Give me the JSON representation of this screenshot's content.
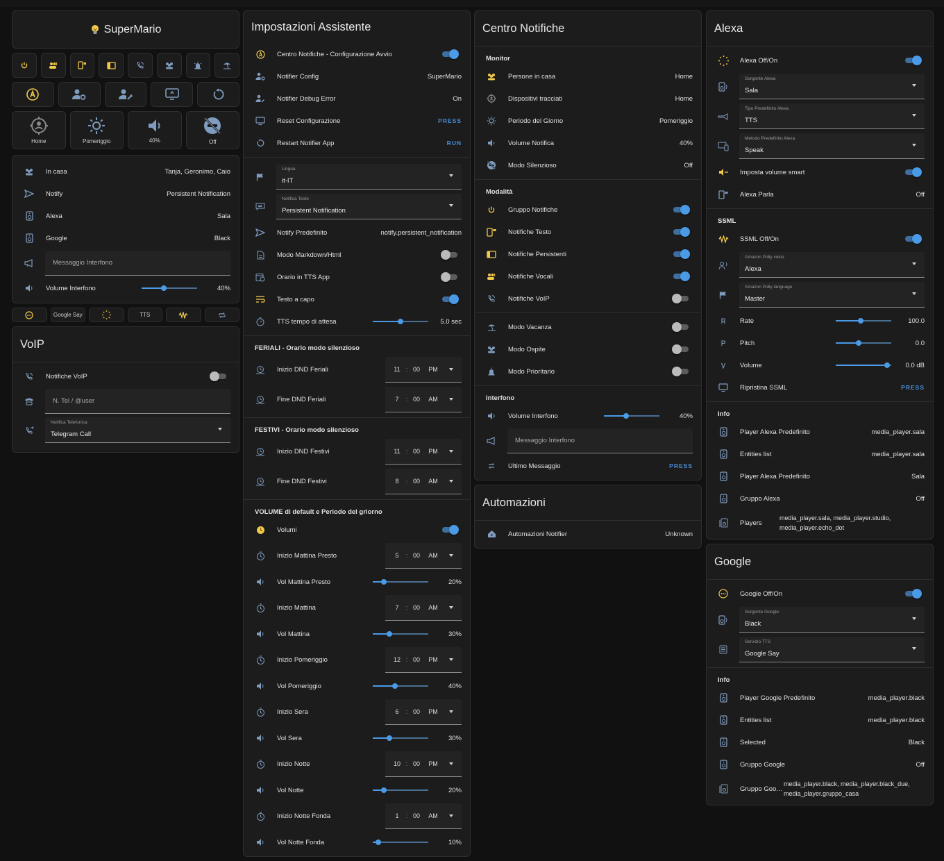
{
  "colors": {
    "accent": "#4a9ae6",
    "icon": "#7f9bbd",
    "yellow": "#f2c94c",
    "bg": "#111111",
    "card": "#1c1c1c"
  },
  "supermario": {
    "title": "SuperMario",
    "row1_icons": [
      "power-icon",
      "voice-group-icon",
      "text-notify-icon",
      "persistent-icon",
      "voip-icon",
      "guest-icon",
      "priority-icon",
      "vacation-icon"
    ],
    "row2_icons": [
      "assistant-badge-icon",
      "account-cog-icon",
      "account-wrench-icon",
      "reset-monitor-icon",
      "restart-icon"
    ],
    "big_buttons": [
      {
        "label": "Home"
      },
      {
        "label": "Pomeriggio"
      },
      {
        "label": "40%"
      },
      {
        "label": "Off"
      }
    ],
    "info": [
      {
        "label": "In casa",
        "value": "Tanja, Geronimo, Caio"
      },
      {
        "label": "Notify",
        "value": "Persistent Notification"
      },
      {
        "label": "Alexa",
        "value": "Sala"
      },
      {
        "label": "Google",
        "value": "Black"
      }
    ],
    "intercom_placeholder": "Messaggio Interfono",
    "intercom_volume_label": "Volume Interfono",
    "intercom_volume_value": "40%",
    "intercom_volume_level": 0.4,
    "chips": [
      {
        "label": ""
      },
      {
        "label": "Google Say"
      },
      {
        "label": ""
      },
      {
        "label": "TTS"
      },
      {
        "label": ""
      },
      {
        "label": ""
      }
    ]
  },
  "voip": {
    "title": "VoIP",
    "toggle_label": "Notifiche VoIP",
    "phone_placeholder": "N. Tel / @user",
    "select_label": "Notifica Telefonica",
    "select_value": "Telegram Call"
  },
  "assistente": {
    "title": "Impostazioni Assistente",
    "rows": [
      {
        "label": "Centro Notifiche - Configurazione Avvio"
      },
      {
        "label": "Notifier Config",
        "value": "SuperMario"
      },
      {
        "label": "Notifier Debug Error",
        "value": "On"
      },
      {
        "label": "Reset Configurazione",
        "action": "PRESS"
      },
      {
        "label": "Restart Notifier App",
        "action": "RUN"
      }
    ],
    "lingua_label": "Lingua",
    "lingua_value": "it-IT",
    "notifica_testo_label": "Notifica Testo",
    "notifica_testo_value": "Persistent Notification",
    "notify_predefinito_label": "Notify Predefinito",
    "notify_predefinito_value": "notify.persistent_notification",
    "markdown_label": "Modo Markdown/Html",
    "orario_tts_label": "Orario in TTS App",
    "testo_capo_label": "Testo a capo",
    "tts_wait_label": "TTS tempo di attesa",
    "tts_wait_value": "5.0 sec",
    "tts_wait_level": 0.5,
    "feriali_header": "FERIALI - Orario modo silenzioso",
    "feriali": [
      {
        "label": "Inizio DND Feriali",
        "h": "11",
        "m": "00",
        "ap": "PM"
      },
      {
        "label": "Fine DND Feriali",
        "h": "7",
        "m": "00",
        "ap": "AM"
      }
    ],
    "festivi_header": "FESTIVI - Orario modo silenzioso",
    "festivi": [
      {
        "label": "Inizio DND Festivi",
        "h": "11",
        "m": "00",
        "ap": "PM"
      },
      {
        "label": "Fine DND Festivi",
        "h": "8",
        "m": "00",
        "ap": "AM"
      }
    ],
    "volume_header": "VOLUME di default e Periodo del griorno",
    "volumi_label": "Volumi",
    "periods": [
      {
        "time_label": "Inizio Mattina Presto",
        "h": "5",
        "m": "00",
        "ap": "AM",
        "vol_label": "Vol Mattina Presto",
        "vol": "20%",
        "level": 0.2
      },
      {
        "time_label": "Inizio Mattina",
        "h": "7",
        "m": "00",
        "ap": "AM",
        "vol_label": "Vol Mattina",
        "vol": "30%",
        "level": 0.3
      },
      {
        "time_label": "Inizio Pomeriggio",
        "h": "12",
        "m": "00",
        "ap": "PM",
        "vol_label": "Vol Pomeriggio",
        "vol": "40%",
        "level": 0.4
      },
      {
        "time_label": "Inizio Sera",
        "h": "6",
        "m": "00",
        "ap": "PM",
        "vol_label": "Vol Sera",
        "vol": "30%",
        "level": 0.3
      },
      {
        "time_label": "Inizio Notte",
        "h": "10",
        "m": "00",
        "ap": "PM",
        "vol_label": "Vol Notte",
        "vol": "20%",
        "level": 0.2
      },
      {
        "time_label": "Inizio Notte Fonda",
        "h": "1",
        "m": "00",
        "ap": "AM",
        "vol_label": "Vol Notte Fonda",
        "vol": "10%",
        "level": 0.1
      }
    ]
  },
  "centro": {
    "title": "Centro Notifiche",
    "monitor_header": "Monitor",
    "monitor": [
      {
        "label": "Persone in casa",
        "value": "Home"
      },
      {
        "label": "Dispositivi tracciati",
        "value": "Home"
      },
      {
        "label": "Periodo del Giorno",
        "value": "Pomeriggio"
      },
      {
        "label": "Volume Notifica",
        "value": "40%"
      },
      {
        "label": "Modo Silenzioso",
        "value": "Off"
      }
    ],
    "modalita_header": "Modalità",
    "modalita": [
      {
        "label": "Gruppo Notifiche",
        "on": true
      },
      {
        "label": "Notifiche Testo",
        "on": true
      },
      {
        "label": "Notifiche Persistenti",
        "on": true
      },
      {
        "label": "Notifiche Vocali",
        "on": true
      },
      {
        "label": "Notifiche VoIP",
        "on": false
      }
    ],
    "modi": [
      {
        "label": "Modo Vacanza",
        "on": false
      },
      {
        "label": "Modo Ospite",
        "on": false
      },
      {
        "label": "Modo Prioritario",
        "on": false
      }
    ],
    "interfono_header": "Interfono",
    "intercom_volume_label": "Volume Interfono",
    "intercom_volume_value": "40%",
    "intercom_volume_level": 0.4,
    "intercom_placeholder": "Messaggio Interfono",
    "last_message_label": "Ultimo Messaggio",
    "last_message_action": "PRESS"
  },
  "automazioni": {
    "title": "Automazioni",
    "label": "Automazioni Notifier",
    "value": "Unknown"
  },
  "alexa": {
    "title": "Alexa",
    "onoff_label": "Alexa Off/On",
    "selects": [
      {
        "label": "Sorgente Alexa",
        "value": "Sala"
      },
      {
        "label": "Tipo Predefinito Alexa",
        "value": "TTS"
      },
      {
        "label": "Metodo Predefinito Alexa",
        "value": "Speak"
      }
    ],
    "smart_volume_label": "Imposta volume smart",
    "parla_label": "Alexa Parla",
    "parla_value": "Off",
    "ssml_header": "SSML",
    "ssml_onoff_label": "SSML Off/On",
    "ssml_selects": [
      {
        "label": "Amazon Polly voice",
        "value": "Alexa"
      },
      {
        "label": "Amazon Polly language",
        "value": "Master"
      }
    ],
    "sliders": [
      {
        "label": "Rate",
        "value": "100.0",
        "level": 0.45
      },
      {
        "label": "Pitch",
        "value": "0.0",
        "level": 0.41
      },
      {
        "label": "Volume",
        "value": "0.0 dB",
        "level": 0.93
      }
    ],
    "ripristina_label": "Ripristina SSML",
    "ripristina_action": "PRESS",
    "info_header": "Info",
    "info": [
      {
        "label": "Player Alexa Predefinito",
        "value": "media_player.sala"
      },
      {
        "label": "Entities list",
        "value": "media_player.sala"
      },
      {
        "label": "Player Alexa Predefinito",
        "value": "Sala"
      },
      {
        "label": "Gruppo Alexa",
        "value": "Off"
      }
    ],
    "players_label": "Players",
    "players_value": "media_player.sala, media_player.studio, media_player.echo_dot"
  },
  "google": {
    "title": "Google",
    "onoff_label": "Google Off/On",
    "selects": [
      {
        "label": "Sorgente Google",
        "value": "Black"
      },
      {
        "label": "Servizio TTS",
        "value": "Google Say"
      }
    ],
    "info_header": "Info",
    "info": [
      {
        "label": "Player Google Predefinito",
        "value": "media_player.black"
      },
      {
        "label": "Entities list",
        "value": "media_player.black"
      },
      {
        "label": "Selected",
        "value": "Black"
      },
      {
        "label": "Gruppo Google",
        "value": "Off"
      }
    ],
    "group2_label": "Gruppo Goog...",
    "group2_value": "media_player.black, media_player.black_due, media_player.gruppo_casa"
  }
}
